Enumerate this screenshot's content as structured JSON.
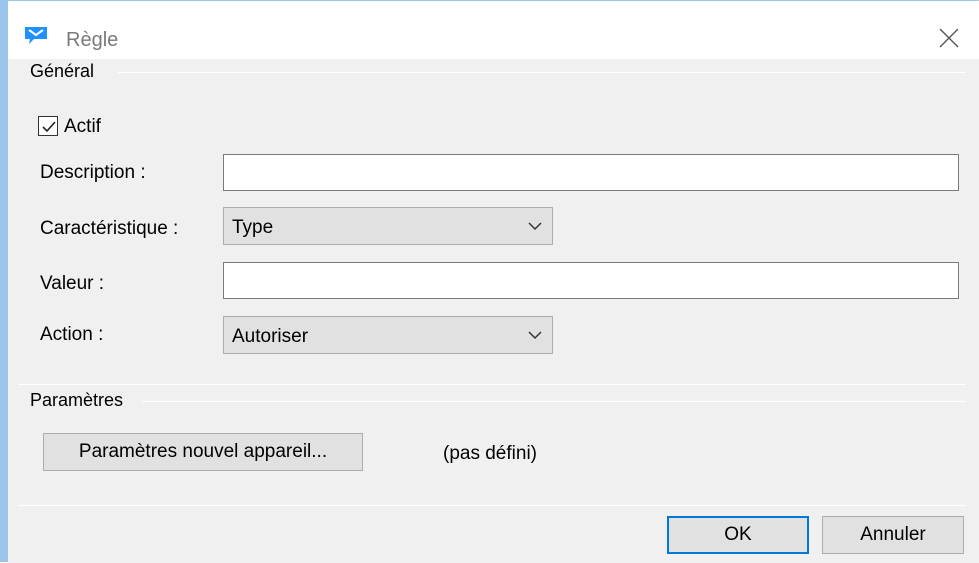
{
  "window": {
    "title": "Règle",
    "icon": "chat-bubble-icon"
  },
  "general": {
    "group_title": "Général",
    "active_label": "Actif",
    "active_checked": true,
    "description_label": "Description :",
    "description_value": "",
    "characteristic_label": "Caractéristique :",
    "characteristic_value": "Type",
    "value_label": "Valeur :",
    "value_value": "",
    "action_label": "Action :",
    "action_value": "Autoriser"
  },
  "parameters": {
    "group_title": "Paramètres",
    "new_device_button": "Paramètres nouvel appareil...",
    "status_text": "(pas défini)"
  },
  "footer": {
    "ok_label": "OK",
    "cancel_label": "Annuler"
  },
  "colors": {
    "accent": "#0078d7",
    "window_border": "#9cc5ec",
    "icon": "#1e90ff"
  }
}
